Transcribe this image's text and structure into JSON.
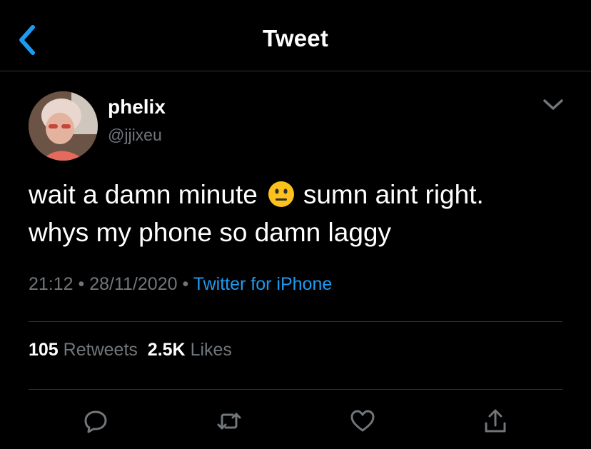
{
  "header": {
    "title": "Tweet",
    "back_icon": "chevron-left-icon"
  },
  "tweet": {
    "author": {
      "display_name": "phelix",
      "handle": "@jjixeu"
    },
    "text_line1_before_emoji": "wait a damn minute",
    "emoji": "neutral-face-emoji",
    "text_line1_after_emoji": "sumn aint right.",
    "text_line2": "whys my phone so damn laggy",
    "time": "21:12",
    "separator": "•",
    "date": "28/11/2020",
    "source": "Twitter for iPhone"
  },
  "stats": {
    "retweets_count": "105",
    "retweets_label": "Retweets",
    "likes_count": "2.5K",
    "likes_label": "Likes"
  },
  "actions": [
    "reply-icon",
    "retweet-icon",
    "like-icon",
    "share-icon"
  ],
  "colors": {
    "background": "#000000",
    "accent": "#1d9bf0",
    "secondary_text": "#71767b",
    "divider": "#2f3336",
    "back_chevron": "#1d9bf0"
  }
}
